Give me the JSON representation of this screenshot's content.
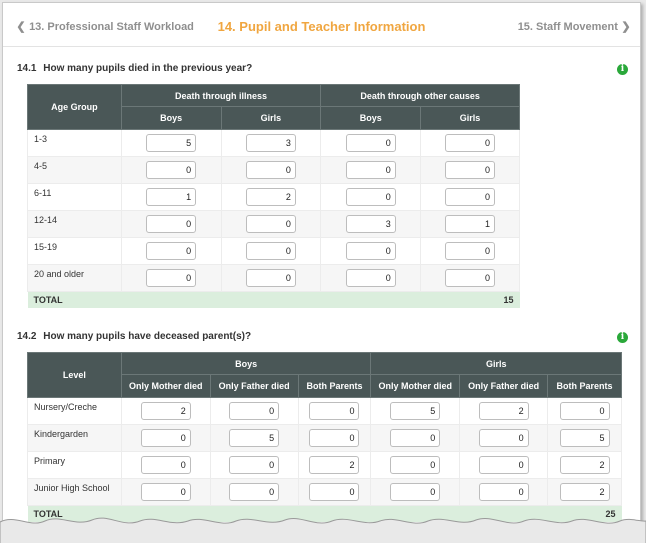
{
  "nav": {
    "prev_label": "13. Professional Staff Workload",
    "title": "14. Pupil and Teacher Information",
    "next_label": "15. Staff Movement"
  },
  "section1": {
    "number": "14.1",
    "question": "How many pupils died in the previous year?",
    "col_group_header": "Age Group",
    "group_headers": [
      "Death through illness",
      "Death through other causes"
    ],
    "sub_headers": [
      "Boys",
      "Girls",
      "Boys",
      "Girls"
    ],
    "rows": [
      {
        "label": "1-3",
        "values": [
          "5",
          "3",
          "0",
          "0"
        ]
      },
      {
        "label": "4-5",
        "values": [
          "0",
          "0",
          "0",
          "0"
        ]
      },
      {
        "label": "6-11",
        "values": [
          "1",
          "2",
          "0",
          "0"
        ]
      },
      {
        "label": "12-14",
        "values": [
          "0",
          "0",
          "3",
          "1"
        ]
      },
      {
        "label": "15-19",
        "values": [
          "0",
          "0",
          "0",
          "0"
        ]
      },
      {
        "label": "20 and older",
        "values": [
          "0",
          "0",
          "0",
          "0"
        ]
      }
    ],
    "total_label": "TOTAL",
    "total_value": "15"
  },
  "section2": {
    "number": "14.2",
    "question": "How many pupils have deceased parent(s)?",
    "col_group_header": "Level",
    "group_headers": [
      "Boys",
      "Girls"
    ],
    "sub_headers": [
      "Only Mother died",
      "Only Father died",
      "Both Parents",
      "Only Mother died",
      "Only Father died",
      "Both Parents"
    ],
    "rows": [
      {
        "label": "Nursery/Creche",
        "values": [
          "2",
          "0",
          "0",
          "5",
          "2",
          "0"
        ]
      },
      {
        "label": "Kindergarden",
        "values": [
          "0",
          "5",
          "0",
          "0",
          "0",
          "5"
        ]
      },
      {
        "label": "Primary",
        "values": [
          "0",
          "0",
          "2",
          "0",
          "0",
          "2"
        ]
      },
      {
        "label": "Junior High School",
        "values": [
          "0",
          "0",
          "0",
          "0",
          "0",
          "2"
        ]
      }
    ],
    "total_label": "TOTAL",
    "total_value": "25"
  },
  "colors": {
    "accent": "#f0a640",
    "header_bg": "#4a5757",
    "total_bg": "#dbeedd",
    "info_icon": "#2aa83a"
  },
  "icons": {
    "prev": "chevron-left-icon",
    "next": "chevron-right-icon",
    "info": "info-icon"
  }
}
